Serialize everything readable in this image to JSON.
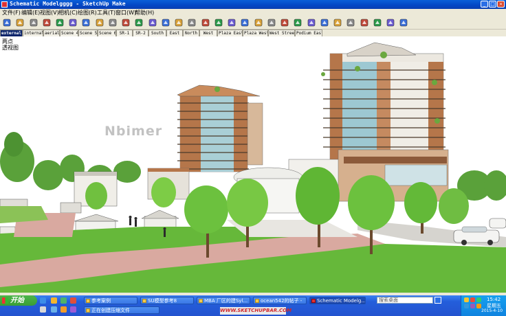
{
  "window": {
    "title": "Schematic Modelgggg - SketchUp Make"
  },
  "menu": [
    "文件(F)",
    "编辑(E)",
    "视图(V)",
    "相机(C)",
    "绘图(R)",
    "工具(T)",
    "窗口(W)",
    "帮助(H)"
  ],
  "toolbar": {
    "icons": [
      "select-icon",
      "eraser-icon",
      "paint-icon",
      "rectangle-icon",
      "circle-icon",
      "line-icon",
      "home-icon",
      "push-pull-icon",
      "move-icon",
      "orbit-icon",
      "pan-icon",
      "zoom-icon",
      "zoom-extents-icon",
      "walk-icon",
      "look-around-icon",
      "section-icon",
      "component-icon",
      "warehouse-icon",
      "extension-icon",
      "print-icon",
      "undo-icon",
      "redo-icon",
      "cut-icon",
      "copy-icon",
      "paste-icon",
      "tape-icon",
      "dimension-icon",
      "text-icon",
      "axes-icon",
      "position-camera-icon",
      "footprints-icon"
    ]
  },
  "scene_tabs": [
    {
      "label": "external",
      "active": true
    },
    {
      "label": "internal",
      "active": false
    },
    {
      "label": "aerial",
      "active": false
    },
    {
      "label": "Scene 4",
      "active": false
    },
    {
      "label": "Scene 5",
      "active": false
    },
    {
      "label": "Scene 6",
      "active": false
    },
    {
      "label": "SR-1",
      "active": false
    },
    {
      "label": "SR-2",
      "active": false
    },
    {
      "label": "South",
      "active": false
    },
    {
      "label": "East",
      "active": false
    },
    {
      "label": "North",
      "active": false
    },
    {
      "label": "West",
      "active": false
    },
    {
      "label": "Plaza East",
      "active": false
    },
    {
      "label": "Plaza West",
      "active": false
    },
    {
      "label": "West Street",
      "active": false
    },
    {
      "label": "Podium East",
      "active": false
    }
  ],
  "viewport": {
    "camera_label_1": "两点",
    "camera_label_2": "透视图",
    "watermark": "Nbimer"
  },
  "taskbar": {
    "start_label": "开始",
    "tasks": [
      {
        "label": "参考案例",
        "active": false
      },
      {
        "label": "SU模型参考8",
        "active": false
      },
      {
        "label": "MBA 厂区的建Syl...",
        "active": false
      },
      {
        "label": "ocean542的帖子 -",
        "active": false
      },
      {
        "label": "Schematic Modelg...",
        "active": true
      },
      {
        "label": "正在创建压缩文件",
        "active": false
      }
    ],
    "search_placeholder": "搜索桌面",
    "site_banner": "WWW.SKETCHUPBAR.COM",
    "clock": "15:42",
    "weekday": "星期五",
    "date": "2015-4-10"
  },
  "colors": {
    "titlebar": "#0346c4",
    "chrome": "#ece9d8",
    "taskbar": "#245edb",
    "start": "#3a9e36",
    "brick": "#b5764a",
    "grass": "#66b83a",
    "path": "#d9a9a0"
  }
}
